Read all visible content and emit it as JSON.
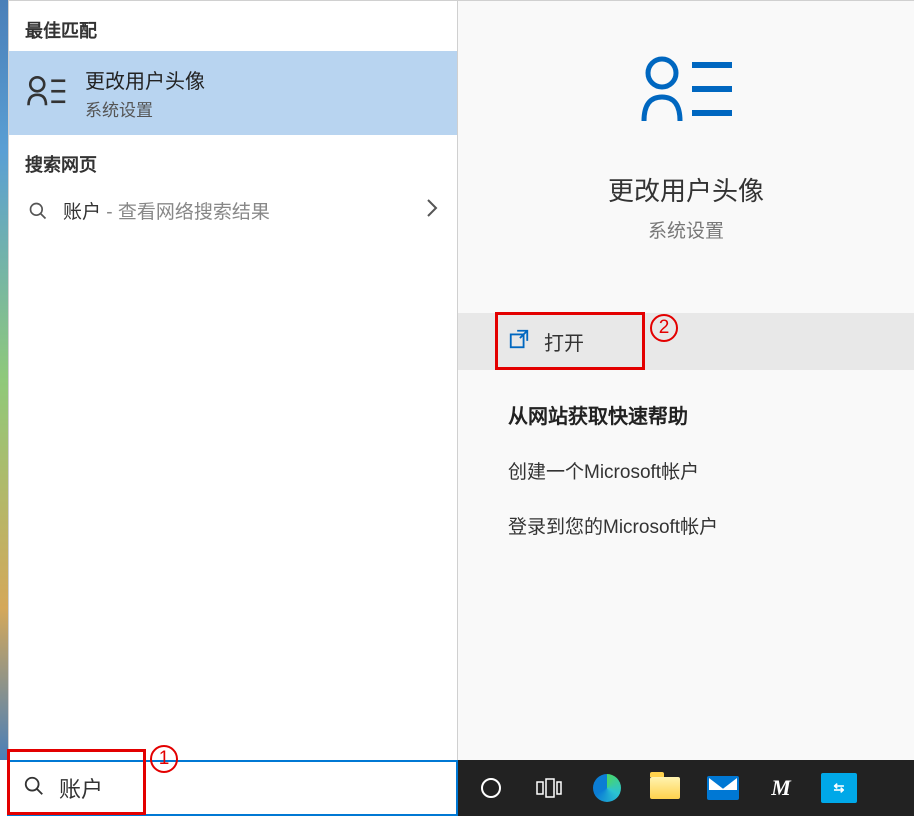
{
  "leftPanel": {
    "bestMatchHeader": "最佳匹配",
    "bestMatch": {
      "title": "更改用户头像",
      "subtitle": "系统设置"
    },
    "webHeader": "搜索网页",
    "webResult": {
      "term": "账户",
      "suffix": " - 查看网络搜索结果"
    }
  },
  "detail": {
    "title": "更改用户头像",
    "subtitle": "系统设置",
    "openLabel": "打开",
    "helpHeading": "从网站获取快速帮助",
    "helpLinks": [
      "创建一个Microsoft帐户",
      "登录到您的Microsoft帐户"
    ]
  },
  "searchBox": {
    "value": "账户"
  },
  "annotations": {
    "label1": "1",
    "label2": "2"
  },
  "colors": {
    "accent": "#0078d4",
    "highlight": "#b8d4f0",
    "annotation": "#e30000"
  }
}
